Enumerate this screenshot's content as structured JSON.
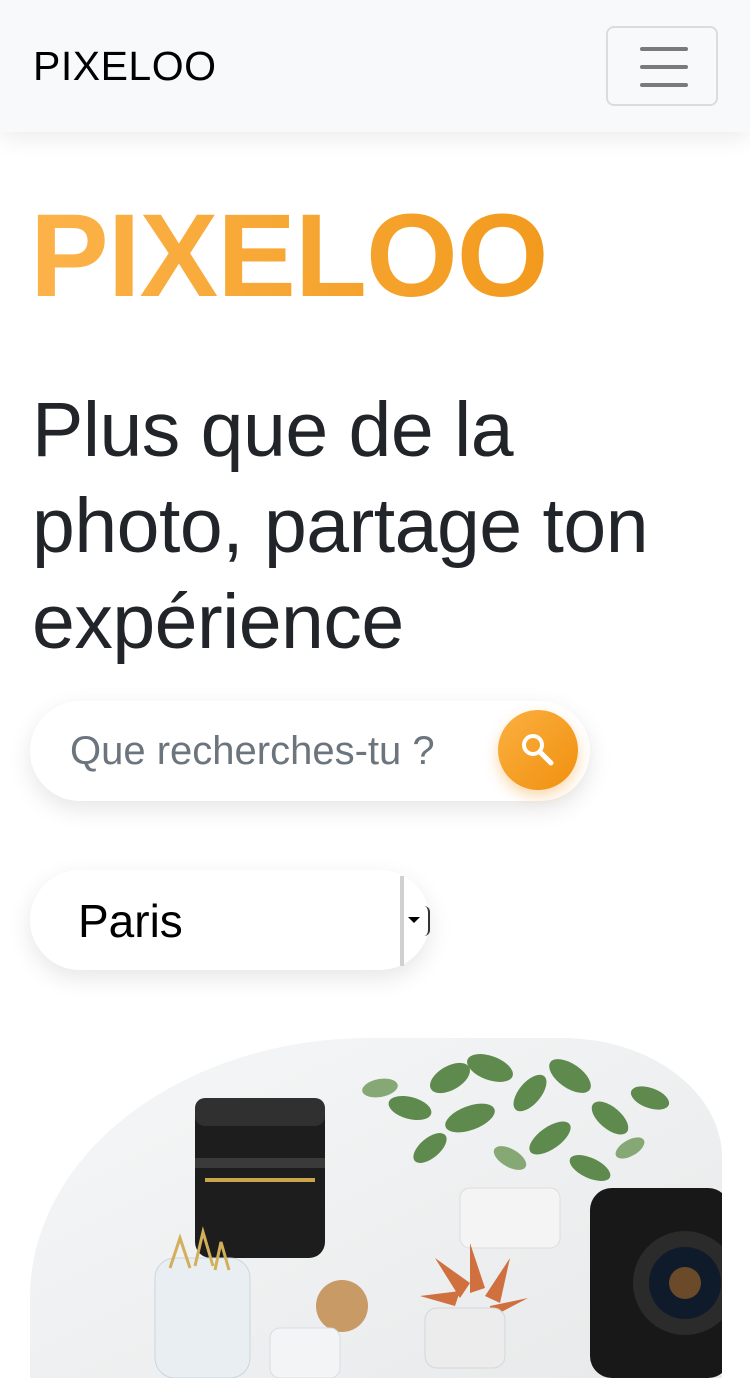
{
  "navbar": {
    "brand": "PIXELOO",
    "toggler_icon": "hamburger-menu-icon"
  },
  "hero": {
    "title": "PIXELOO",
    "title_gradient": [
      "#fcb34a",
      "#f29a1d"
    ],
    "tagline": "Plus que de la photo, partage ton expérience"
  },
  "search": {
    "placeholder": "Que recherches-tu ?",
    "value": "",
    "button_icon": "search-icon",
    "button_color": "#f29a1d"
  },
  "city_select": {
    "selected": "Paris",
    "arrow_icon": "caret-down-icon"
  },
  "image": {
    "subject": "cameras-plants-desk-photo"
  }
}
